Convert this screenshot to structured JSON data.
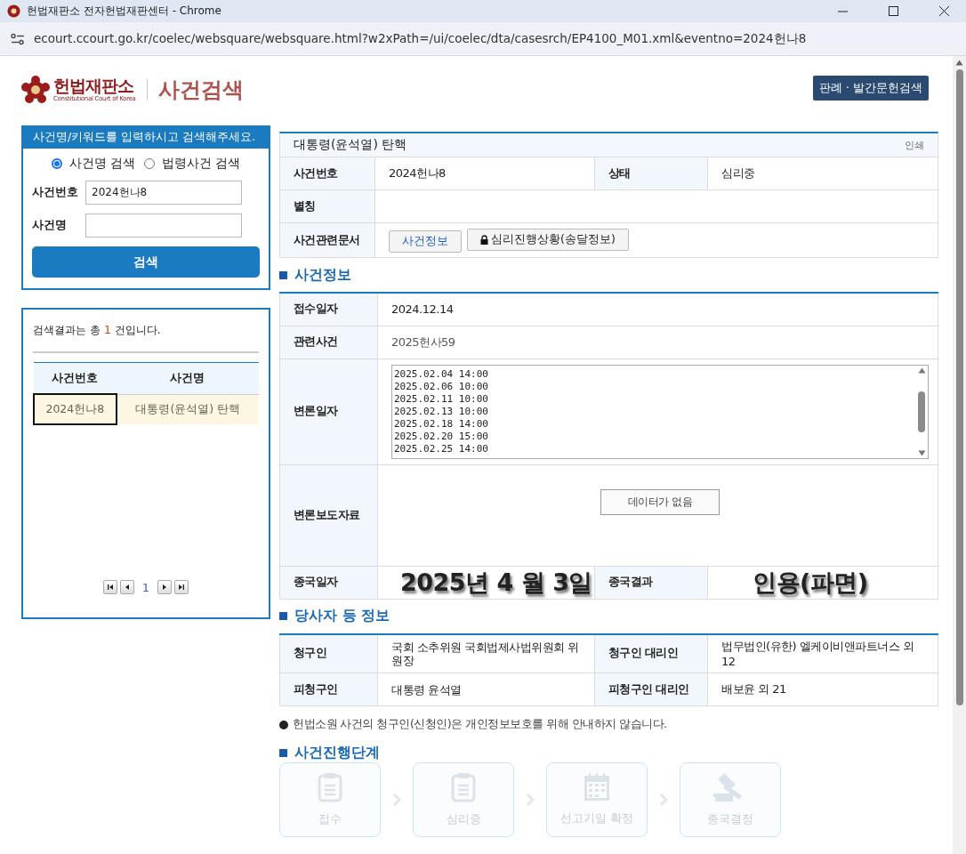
{
  "window": {
    "title": "헌법재판소 전자헌법재판센터 - Chrome",
    "url": "ecourt.ccourt.go.kr/coelec/websquare/websquare.html?w2xPath=/ui/coelec/dta/casesrch/EP4100_M01.xml&eventno=2024헌나8"
  },
  "header": {
    "logo": "헌법재판소",
    "logo_subtitle": "Constitutional Court of Korea",
    "title": "사건검색",
    "link_button": "판례 · 발간문헌검색"
  },
  "search": {
    "prompt": "사건명/키워드를 입력하시고 검색해주세요.",
    "modes": [
      {
        "label": "사건명 검색",
        "selected": true
      },
      {
        "label": "법령사건 검색",
        "selected": false
      }
    ],
    "fields": [
      {
        "label": "사건번호",
        "value": "2024헌나8"
      },
      {
        "label": "사건명"
      }
    ],
    "button": "검색"
  },
  "results": {
    "summary_prefix": "검색결과는 총",
    "count": "1",
    "summary_suffix": "건입니다.",
    "columns": [
      "사건번호",
      "사건명"
    ],
    "rows": [
      {
        "cells": [
          "2024헌나8",
          "대통령(윤석열) 탄핵"
        ],
        "selected": true
      }
    ],
    "page": "1"
  },
  "case": {
    "title": "대통령(윤석열) 탄핵",
    "print": "인쇄",
    "summary": {
      "case_number_label": "사건번호",
      "case_number": "2024헌나8",
      "status_label": "상태",
      "status": "심리중",
      "alias_label": "별칭",
      "documents_label": "사건관련문서",
      "document_buttons": [
        {
          "label": "사건정보",
          "locked": false
        },
        {
          "label": "심리진행상황(송달정보)",
          "locked": true
        }
      ]
    },
    "info": {
      "heading": "사건정보",
      "received_label": "접수일자",
      "received": "2024.12.14",
      "related_label": "관련사건",
      "related": "2025헌사59",
      "hearings_label": "변론일자",
      "hearings": [
        "2025.02.04 14:00",
        "2025.02.06 10:00",
        "2025.02.11 10:00",
        "2025.02.13 10:00",
        "2025.02.18 14:00",
        "2025.02.20 15:00",
        "2025.02.25 14:00"
      ],
      "press_label": "변론보도자료",
      "press_empty": "데이터가 없음",
      "closed_label": "종국일자",
      "closed_date": "2025년 4 월 3일",
      "result_label": "종국결과",
      "result": "인용(파면)"
    },
    "parties": {
      "heading": "당사자 등 정보",
      "rows": [
        {
          "label": "청구인",
          "value": "국회 소추위원 국회법제사법위원회 위원장",
          "agent_label": "청구인 대리인",
          "agent": "법무법인(유한) 엘케이비앤파트너스 외 12"
        },
        {
          "label": "피청구인",
          "value": "대통령 윤석열",
          "agent_label": "피청구인 대리인",
          "agent": "배보윤 외 21"
        }
      ],
      "note": "헌법소원 사건의 청구인(신청인)은 개인정보보호를 위해 안내하지 않습니다."
    },
    "stages": {
      "heading": "사건진행단계",
      "items": [
        "접수",
        "심리중",
        "선고기일 확정",
        "종국결정"
      ]
    }
  }
}
